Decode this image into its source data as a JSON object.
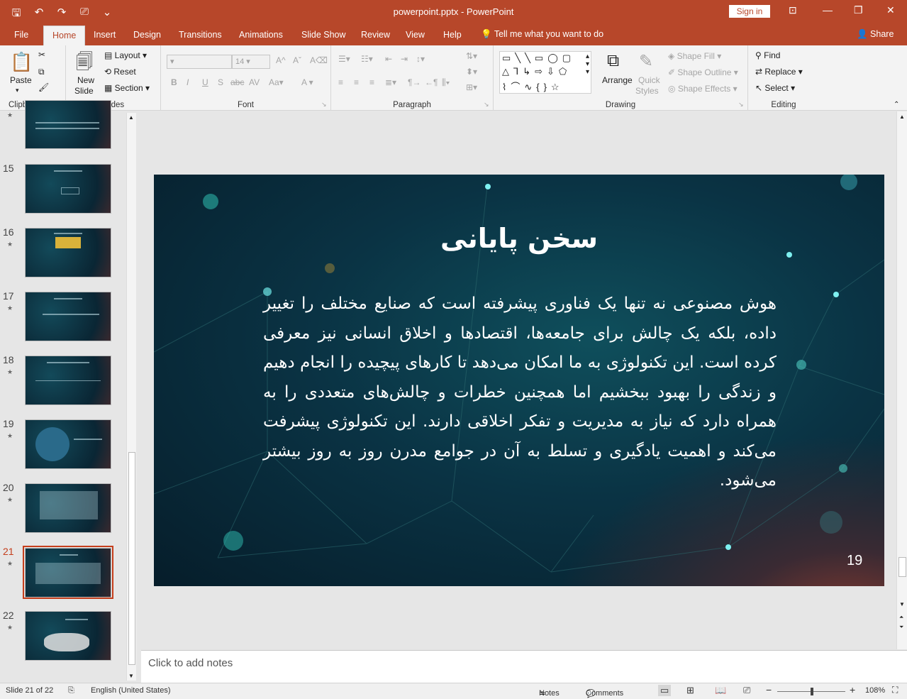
{
  "titlebar": {
    "title": "powerpoint.pptx  -  PowerPoint",
    "sign_in": "Sign in"
  },
  "tabs": [
    "File",
    "Home",
    "Insert",
    "Design",
    "Transitions",
    "Animations",
    "Slide Show",
    "Review",
    "View",
    "Help"
  ],
  "tell_me": "Tell me what you want to do",
  "share": "Share",
  "ribbon": {
    "clipboard": {
      "label": "Clipboard",
      "paste": "Paste"
    },
    "slides": {
      "label": "Slides",
      "new_slide_1": "New",
      "new_slide_2": "Slide",
      "layout": "Layout",
      "reset": "Reset",
      "section": "Section"
    },
    "font": {
      "label": "Font",
      "size": "14"
    },
    "paragraph": {
      "label": "Paragraph"
    },
    "drawing": {
      "label": "Drawing",
      "arrange": "Arrange",
      "quick_1": "Quick",
      "quick_2": "Styles",
      "shape_fill": "Shape Fill",
      "shape_outline": "Shape Outline",
      "shape_effects": "Shape Effects"
    },
    "editing": {
      "label": "Editing",
      "find": "Find",
      "replace": "Replace",
      "select": "Select"
    }
  },
  "thumbnails": [
    {
      "num": "15"
    },
    {
      "num": "16"
    },
    {
      "num": "17"
    },
    {
      "num": "18"
    },
    {
      "num": "19"
    },
    {
      "num": "20"
    },
    {
      "num": "21"
    },
    {
      "num": "22"
    }
  ],
  "slide": {
    "title": "سخن پایانی",
    "body": "هوش مصنوعی نه تنها یک فناوری پیشرفته است که صنایع مختلف را تغییر داده، بلکه یک چالش برای جامعه‌ها، اقتصادها و اخلاق انسانی نیز معرفی کرده است. این تکنولوژی به ما امکان می‌دهد تا کارهای پیچیده را انجام دهیم و زندگی را بهبود ببخشیم اما همچنین خطرات و چالش‌های متعددی را به همراه دارد که نیاز به مدیریت و تفکر اخلاقی دارند. این تکنولوژی پیشرفت می‌کند و اهمیت یادگیری و تسلط به آن در جوامع مدرن روز به روز بیشتر می‌شود.",
    "number": "19"
  },
  "notes_placeholder": "Click to add notes",
  "status": {
    "slide_info": "Slide 21 of 22",
    "language": "English (United States)",
    "notes": "Notes",
    "comments": "Comments",
    "zoom": "108%"
  }
}
